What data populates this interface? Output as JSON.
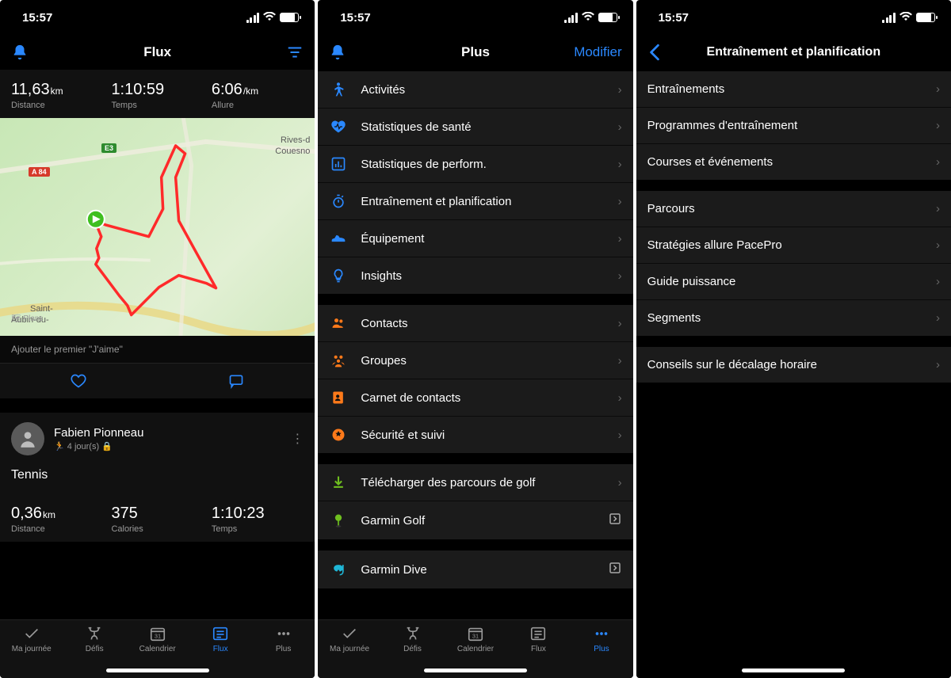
{
  "statusbar": {
    "time": "15:57"
  },
  "colors": {
    "accent_blue": "#2a88ff",
    "accent_orange": "#ff7a1a",
    "accent_green": "#6fbf1f",
    "accent_teal": "#1fb6d6"
  },
  "screen1": {
    "title": "Flux",
    "stats": [
      {
        "value": "11,63",
        "unit": "km",
        "label": "Distance"
      },
      {
        "value": "1:10:59",
        "unit": "",
        "label": "Temps"
      },
      {
        "value": "6:06",
        "unit": "/km",
        "label": "Allure"
      }
    ],
    "map": {
      "labels": [
        {
          "text": "Rives-d",
          "sub": "Couesno"
        },
        {
          "text": "Saint-"
        },
        {
          "text": "Aubin-du-"
        }
      ],
      "roads": [
        "E3",
        "A 84"
      ]
    },
    "like_hint": "Ajouter le premier \"J'aime\"",
    "card2": {
      "name": "Fabien Pionneau",
      "sub": "4 jour(s)",
      "title": "Tennis",
      "stats": [
        {
          "value": "0,36",
          "unit": "km",
          "label": "Distance"
        },
        {
          "value": "375",
          "unit": "",
          "label": "Calories"
        },
        {
          "value": "1:10:23",
          "unit": "",
          "label": "Temps"
        }
      ]
    },
    "tabs": [
      "Ma journée",
      "Défis",
      "Calendrier",
      "Flux",
      "Plus"
    ],
    "tabs_active": 3
  },
  "screen2": {
    "title": "Plus",
    "right_action": "Modifier",
    "groups": [
      [
        {
          "icon": "person-arms",
          "color": "#2a88ff",
          "label": "Activités"
        },
        {
          "icon": "heart-pulse",
          "color": "#2a88ff",
          "label": "Statistiques de santé"
        },
        {
          "icon": "chart-bar",
          "color": "#2a88ff",
          "label": "Statistiques de perform."
        },
        {
          "icon": "stopwatch",
          "color": "#2a88ff",
          "label": "Entraînement et planification"
        },
        {
          "icon": "shoe",
          "color": "#2a88ff",
          "label": "Équipement"
        },
        {
          "icon": "lightbulb",
          "color": "#2a88ff",
          "label": "Insights"
        }
      ],
      [
        {
          "icon": "contacts",
          "color": "#ff7a1a",
          "label": "Contacts"
        },
        {
          "icon": "groups",
          "color": "#ff7a1a",
          "label": "Groupes"
        },
        {
          "icon": "address-book",
          "color": "#ff7a1a",
          "label": "Carnet de contacts"
        },
        {
          "icon": "shield-star",
          "color": "#ff7a1a",
          "label": "Sécurité et suivi"
        }
      ],
      [
        {
          "icon": "download",
          "color": "#6fbf1f",
          "label": "Télécharger des parcours de golf"
        },
        {
          "icon": "golf",
          "color": "#6fbf1f",
          "label": "Garmin Golf",
          "trailing": "external"
        }
      ],
      [
        {
          "icon": "snorkel",
          "color": "#1fb6d6",
          "label": "Garmin Dive",
          "trailing": "external"
        }
      ]
    ],
    "tabs": [
      "Ma journée",
      "Défis",
      "Calendrier",
      "Flux",
      "Plus"
    ],
    "tabs_active": 4
  },
  "screen3": {
    "title": "Entraînement et planification",
    "groups": [
      [
        "Entraînements",
        "Programmes d'entraînement",
        "Courses et événements"
      ],
      [
        "Parcours",
        "Stratégies allure PacePro",
        "Guide puissance",
        "Segments"
      ],
      [
        "Conseils sur le décalage horaire"
      ]
    ]
  }
}
